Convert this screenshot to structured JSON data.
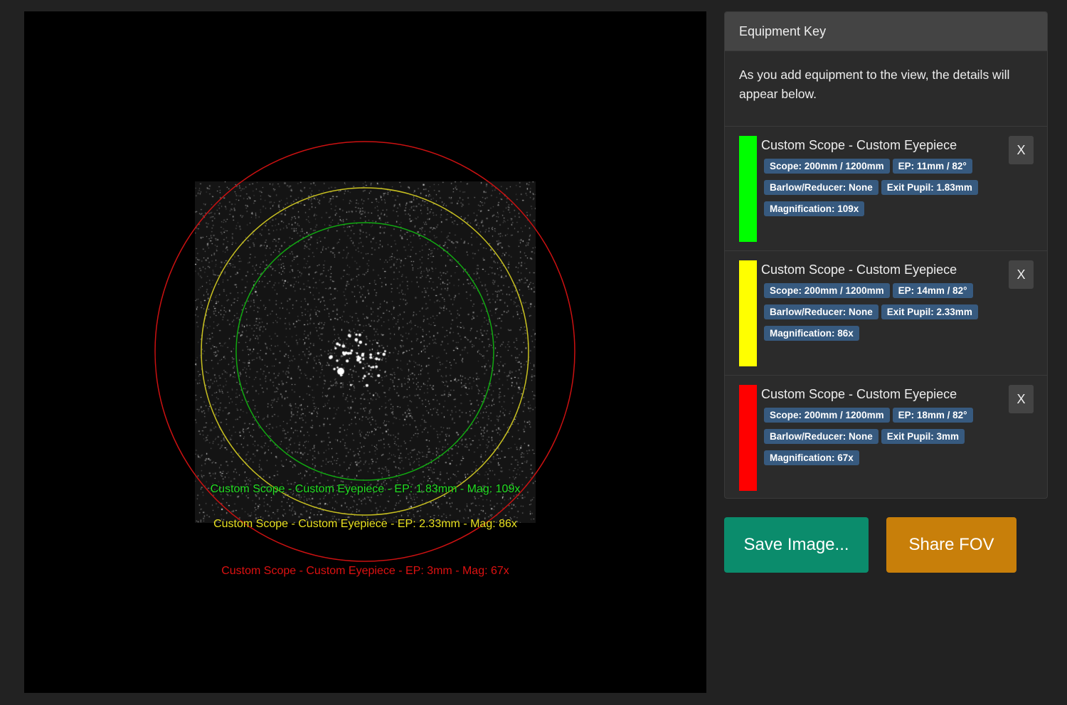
{
  "view": {
    "labels": [
      {
        "text": "Custom Scope - Custom Eyepiece - EP: 1.83mm - Mag: 109x",
        "color": "#22dd22"
      },
      {
        "text": "Custom Scope - Custom Eyepiece - EP: 2.33mm - Mag: 86x",
        "color": "#e8e020"
      },
      {
        "text": "Custom Scope - Custom Eyepiece - EP: 3mm - Mag: 67x",
        "color": "#dd1111"
      }
    ]
  },
  "panel": {
    "header": "Equipment Key",
    "intro": "As you add equipment to the view, the details will appear below.",
    "items": [
      {
        "color": "#00ff00",
        "title": "Custom Scope - Custom Eyepiece",
        "scope": "Scope: 200mm / 1200mm",
        "ep": "EP: 11mm / 82°",
        "barlow": "Barlow/Reducer: None",
        "exit": "Exit Pupil: 1.83mm",
        "mag": "Magnification: 109x",
        "close": "X"
      },
      {
        "color": "#ffff00",
        "title": "Custom Scope - Custom Eyepiece",
        "scope": "Scope: 200mm / 1200mm",
        "ep": "EP: 14mm / 82°",
        "barlow": "Barlow/Reducer: None",
        "exit": "Exit Pupil: 2.33mm",
        "mag": "Magnification: 86x",
        "close": "X"
      },
      {
        "color": "#ff0000",
        "title": "Custom Scope - Custom Eyepiece",
        "scope": "Scope: 200mm / 1200mm",
        "ep": "EP: 18mm / 82°",
        "barlow": "Barlow/Reducer: None",
        "exit": "Exit Pupil: 3mm",
        "mag": "Magnification: 67x",
        "close": "X"
      }
    ]
  },
  "buttons": {
    "save": "Save Image...",
    "share": "Share FOV",
    "save_color": "#0b8c6c",
    "share_color": "#c87f0a"
  }
}
